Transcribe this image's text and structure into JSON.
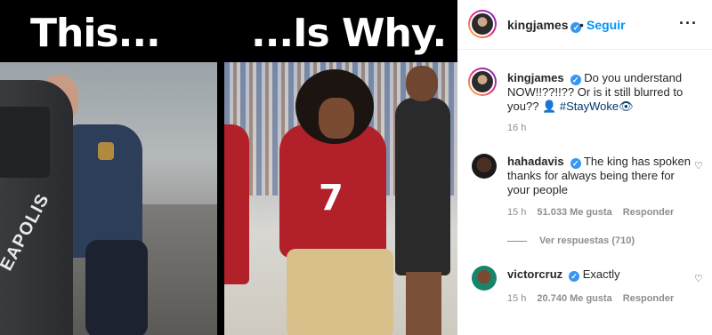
{
  "post_image": {
    "caption_left": "This...",
    "caption_right": "...Is Why.",
    "car_text": "EAPOLIS",
    "jersey_number": "7"
  },
  "header": {
    "username": "kingjames",
    "separator": "•",
    "follow_label": "Seguir",
    "more_icon": "···"
  },
  "post": {
    "username": "kingjames",
    "text": "Do you understand NOW!!??!!?? Or is it still blurred to you?? 👤 ",
    "hashtag": "#StayWoke👁",
    "time": "16 h"
  },
  "comments": [
    {
      "username": "hahadavis",
      "text": "The king has spoken thanks for always being there for your people",
      "time": "15 h",
      "likes": "51.033 Me gusta",
      "reply_label": "Responder"
    },
    {
      "username": "victorcruz",
      "text": "Exactly",
      "time": "15 h",
      "likes": "20.740 Me gusta",
      "reply_label": "Responder"
    }
  ],
  "view_replies_label": "Ver respuestas (710)",
  "colors": {
    "accent": "#0095f6",
    "verified": "#3897f0",
    "muted": "#8e8e8e",
    "hashtag": "#00376b"
  }
}
